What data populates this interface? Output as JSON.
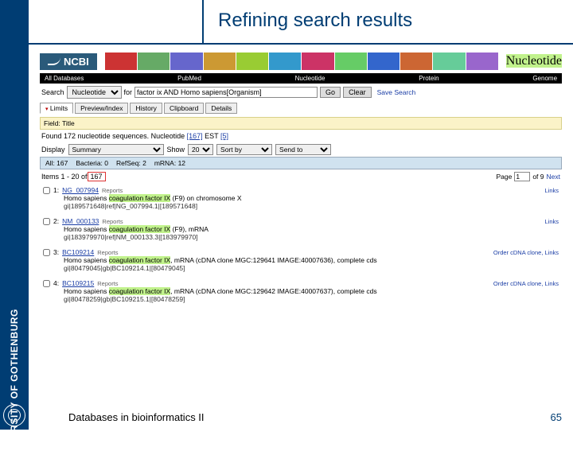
{
  "brand": {
    "university": "UNIVERSITY OF GOTHENBURG"
  },
  "slide": {
    "title": "Refining search results",
    "footer_text": "Databases in bioinformatics II",
    "page_number": "65"
  },
  "ncbi": {
    "logo": "NCBI",
    "nucleotide_label": "Nucleotide"
  },
  "blackbar": {
    "all": "All Databases",
    "pubmed": "PubMed",
    "nucl": "Nucleotide",
    "protein": "Protein",
    "genome": "Genome"
  },
  "search": {
    "label": "Search",
    "db": "Nucleotide",
    "for": "for",
    "query": "factor ix AND Homo sapiens[Organism]",
    "go": "Go",
    "clear": "Clear",
    "save": "Save Search"
  },
  "tabs": {
    "limits": "Limits",
    "preview": "Preview/Index",
    "history": "History",
    "clipboard": "Clipboard",
    "details": "Details"
  },
  "fieldtitle": "Field: Title",
  "found": {
    "text": "Found 172 nucleotide sequences.    Nucleotide ",
    "nucl": "[167]",
    "mid": " EST ",
    "est": "[5]"
  },
  "displayrow": {
    "display": "Display",
    "summary": "Summary",
    "show": "Show",
    "shownum": "20",
    "sortby": "Sort by",
    "sendto": "Send to"
  },
  "catbar": {
    "all": "All: 167",
    "bacteria": "Bacteria: 0",
    "refseq": "RefSeq: 2",
    "mrna": "mRNA: 12"
  },
  "items": {
    "prefix": "Items 1 - 20 of ",
    "count": "167",
    "page_lbl": "Page",
    "page_val": "1",
    "of": "of 9",
    "next": "Next"
  },
  "results": [
    {
      "idx": "1:",
      "acc": "NG_007994",
      "reports": "Reports",
      "links": "Links",
      "desc_pre": "Homo sapiens ",
      "desc_hl": "coagulation factor IX",
      "desc_post": " (F9) on chromosome X",
      "gi": "gi|189571648|ref|NG_007994.1|[189571648]"
    },
    {
      "idx": "2:",
      "acc": "NM_000133",
      "reports": "Reports",
      "links": "Links",
      "desc_pre": "Homo sapiens ",
      "desc_hl": "coagulation factor IX",
      "desc_post": " (F9), mRNA",
      "gi": "gi|183979970|ref|NM_000133.3|[183979970]"
    },
    {
      "idx": "3:",
      "acc": "BC109214",
      "reports": "Reports",
      "links": "Order cDNA clone, Links",
      "desc_pre": "Homo sapiens ",
      "desc_hl": "coagulation factor IX",
      "desc_post": ", mRNA (cDNA clone MGC:129641 IMAGE:40007636), complete cds",
      "gi": "gi|80479045|gb|BC109214.1|[80479045]"
    },
    {
      "idx": "4:",
      "acc": "BC109215",
      "reports": "Reports",
      "links": "Order cDNA clone, Links",
      "desc_pre": "Homo sapiens ",
      "desc_hl": "coagulation factor IX",
      "desc_post": ", mRNA (cDNA clone MGC:129642 IMAGE:40007637), complete cds",
      "gi": "gi|80478259|gb|BC109215.1|[80478259]"
    }
  ]
}
